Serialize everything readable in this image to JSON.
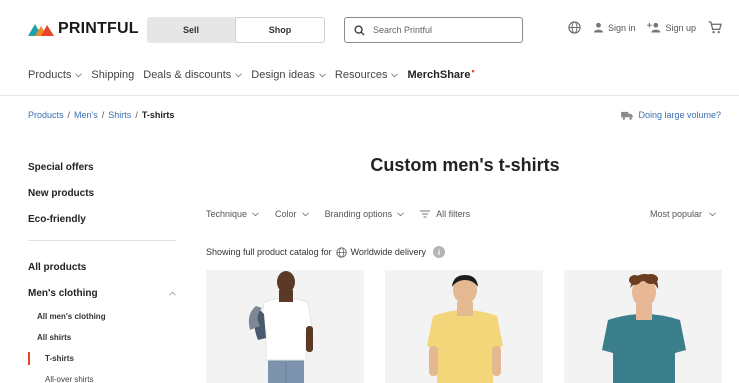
{
  "brand": {
    "name": "PRINTFUL",
    "colors": {
      "accent": "#e8432b",
      "logo_dark": "#1a1a1a",
      "logo_teal": "#1fa2a8",
      "logo_orange": "#f08a24",
      "link": "#3a6fb0"
    }
  },
  "header": {
    "mode_tabs": [
      {
        "label": "Sell",
        "active": false
      },
      {
        "label": "Shop",
        "active": true
      }
    ],
    "search": {
      "placeholder": "Search Printful",
      "value": "",
      "icon": "search-icon"
    },
    "actions": [
      {
        "icon": "globe-icon",
        "label": ""
      },
      {
        "icon": "user-icon",
        "label": "Sign in"
      },
      {
        "icon": "add-user-icon",
        "label": "Sign up"
      },
      {
        "icon": "cart-icon",
        "label": ""
      }
    ]
  },
  "nav": {
    "items": [
      {
        "label": "Products",
        "dropdown": true
      },
      {
        "label": "Shipping",
        "dropdown": false
      },
      {
        "label": "Deals & discounts",
        "dropdown": true
      },
      {
        "label": "Design ideas",
        "dropdown": true
      },
      {
        "label": "Resources",
        "dropdown": true
      }
    ],
    "merchshare": {
      "label": "MerchShare",
      "badge": "•"
    }
  },
  "breadcrumb": {
    "items": [
      "Products",
      "Men's",
      "Shirts"
    ],
    "current": "T-shirts",
    "separator": "/"
  },
  "large_volume": {
    "label": "Doing large volume?",
    "icon": "truck-icon"
  },
  "sidebar": {
    "top_links": [
      "Special offers",
      "New products",
      "Eco-friendly"
    ],
    "all_products": "All products",
    "group": {
      "label": "Men's clothing",
      "expanded": true
    },
    "sub_items": [
      {
        "label": "All men's clothing",
        "state": "bold"
      },
      {
        "label": "All shirts",
        "state": "bold"
      },
      {
        "label": "T-shirts",
        "state": "active"
      },
      {
        "label": "All-over shirts",
        "state": "normal"
      }
    ]
  },
  "main": {
    "title": "Custom men's t-shirts",
    "filters": [
      {
        "label": "Technique",
        "dropdown": true
      },
      {
        "label": "Color",
        "dropdown": true
      },
      {
        "label": "Branding options",
        "dropdown": true
      }
    ],
    "all_filters": "All filters",
    "sort": {
      "label": "Most popular"
    },
    "showing": {
      "prefix": "Showing full product catalog for",
      "location": "Worldwide delivery",
      "info": "i"
    },
    "products": [
      {
        "shirt_color": "#ffffff",
        "skin": "#5a3a26",
        "pants": "#7d93ad"
      },
      {
        "shirt_color": "#f3d57a",
        "skin": "#e4b992",
        "pants": ""
      },
      {
        "shirt_color": "#3c7f8c",
        "skin": "#e8b796",
        "pants": ""
      }
    ]
  }
}
